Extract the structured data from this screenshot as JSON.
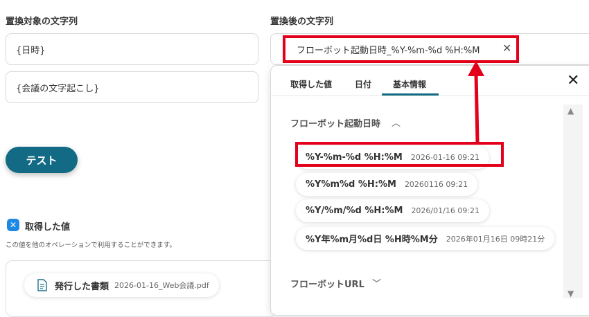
{
  "left": {
    "before_label": "置換対象の文字列",
    "field1_value": "{日時}",
    "field2_value": "{会議の文字起こし}",
    "test_button": "テスト",
    "retrieved_title": "取得した値",
    "retrieved_desc": "この値を他のオペレーションで利用することができます。",
    "doc_chip_label": "発行した書類",
    "doc_chip_value": "2026-01-16_Web会議.pdf"
  },
  "right": {
    "after_label": "置換後の文字列",
    "after_value": "フローボット起動日時_%Y-%m-%d %H:%M"
  },
  "dropdown": {
    "tabs": [
      "取得した値",
      "日付",
      "基本情報"
    ],
    "active_tab": "基本情報",
    "section1": "フローボット起動日時",
    "formats": [
      {
        "fmt": "%Y-%m-%d %H:%M",
        "example": "2026-01-16 09:21"
      },
      {
        "fmt": "%Y%m%d %H:%M",
        "example": "20260116 09:21"
      },
      {
        "fmt": "%Y/%m/%d %H:%M",
        "example": "2026/01/16 09:21"
      },
      {
        "fmt": "%Y年%m月%d日 %H時%M分",
        "example": "2026年01月16日 09時21分"
      }
    ],
    "section2": "フローボットURL"
  },
  "colors": {
    "accent": "#136a84",
    "highlight": "#e3001b",
    "icon_blue": "#1e88e5"
  }
}
